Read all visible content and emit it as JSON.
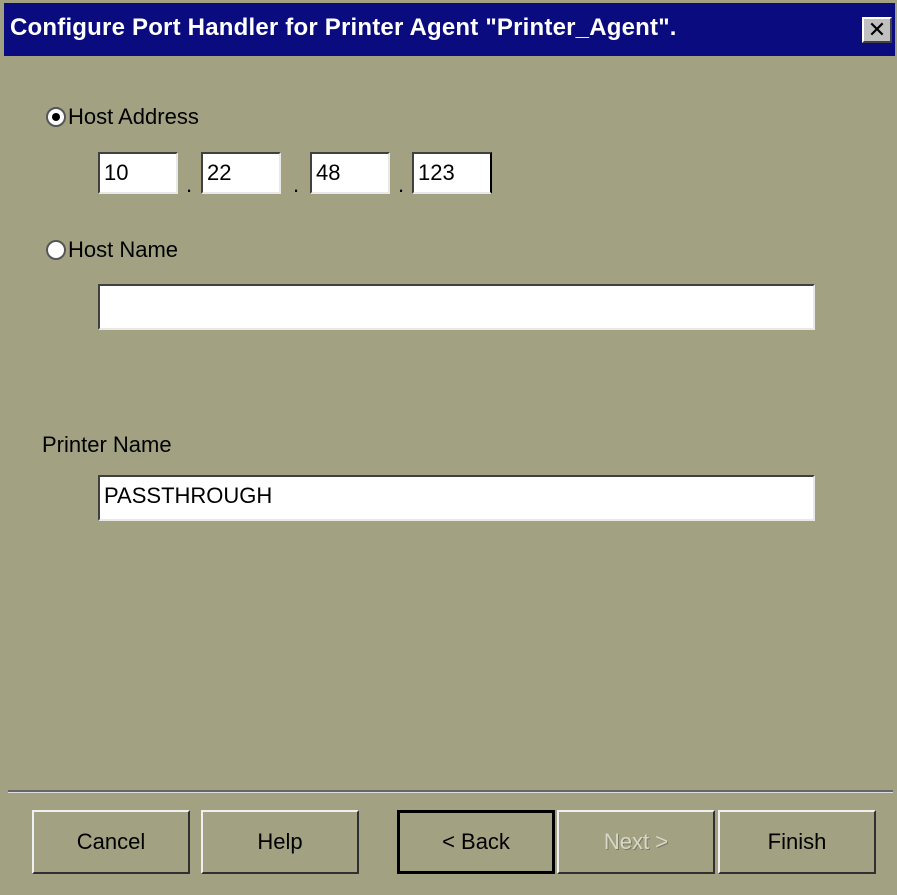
{
  "window": {
    "title": "Configure Port Handler for Printer Agent \"Printer_Agent\".",
    "close_glyph": "✕"
  },
  "host_address": {
    "label": "Host Address",
    "selected": true,
    "octets": [
      "10",
      "22",
      "48",
      "123"
    ],
    "separator": "."
  },
  "host_name": {
    "label": "Host Name",
    "selected": false,
    "value": ""
  },
  "printer_name": {
    "label": "Printer Name",
    "value": "PASSTHROUGH"
  },
  "buttons": {
    "cancel": "Cancel",
    "help": "Help",
    "back": "< Back",
    "next": "Next >",
    "finish": "Finish"
  }
}
